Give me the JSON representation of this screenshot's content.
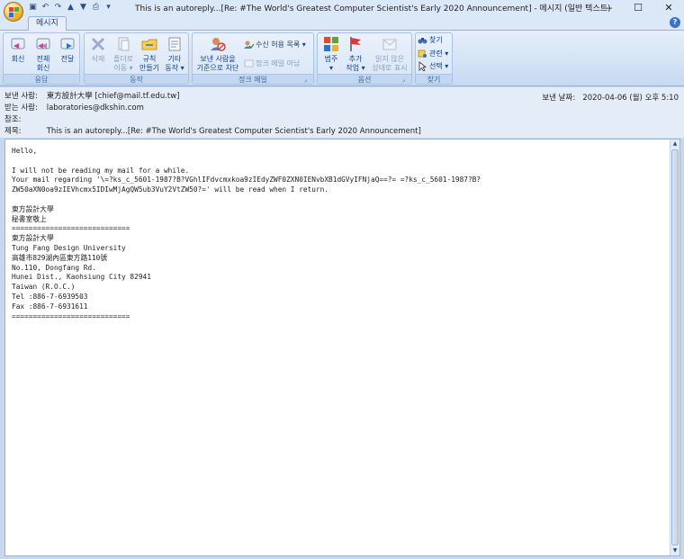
{
  "window": {
    "title": "This is an autoreply...[Re: #The World's Greatest Computer Scientist's Early 2020 Announcement] - 메시지 (일반 텍스트)",
    "minimize": "—",
    "maximize": "☐",
    "close": "✕"
  },
  "tabs": {
    "message": "메시지"
  },
  "ribbon": {
    "respond": {
      "label": "응답",
      "reply": "회신",
      "reply_all_1": "전체",
      "reply_all_2": "회신",
      "forward": "전달"
    },
    "actions": {
      "label": "동작",
      "delete": "삭제",
      "move_1": "폴더로",
      "move_2": "이동 ▾",
      "rules_1": "규칙",
      "rules_2": "만들기",
      "other_1": "기타",
      "other_2": "동작 ▾"
    },
    "junk": {
      "label": "정크 메일",
      "block_1": "보낸 사람을",
      "block_2": "기준으로 차단",
      "safe_list": "수신 허용 목록 ▾",
      "not_junk": "정크 메일 아님"
    },
    "options": {
      "label": "옵션",
      "categorize_1": "범주",
      "categorize_2": "▾",
      "followup_1": "추가",
      "followup_2": "작업 ▾",
      "mark_unread_1": "읽지 않은",
      "mark_unread_2": "상태로 표시"
    },
    "find": {
      "label": "찾기",
      "find": "찾기",
      "related": "관련 ▾",
      "select": "선택 ▾"
    }
  },
  "header": {
    "from_label": "보낸 사람:",
    "from_value": "東方設計大學 [chief@mail.tf.edu.tw]",
    "to_label": "받는 사람:",
    "to_value": "laboratories@dkshin.com",
    "cc_label": "참조:",
    "cc_value": "",
    "subject_label": "제목:",
    "subject_value": "This is an autoreply...[Re: #The World's Greatest Computer Scientist's Early 2020 Announcement]",
    "sent_label": "보낸 날짜:",
    "sent_value": "2020-04-06 (월) 오후 5:10"
  },
  "body": {
    "text": "Hello,\n\nI will not be reading my mail for a while.\nYour mail regarding '\\=?ks_c_5601-1987?B?VGhlIFdvcmxkoa9zIEdyZWF0ZXN0IENvbXB1dGVyIFNjaQ==?= =?ks_c_5601-1987?B?\nZW50aXN0oa9zIEVhcmx5IDIwMjAgQW5ub3VuY2VtZW50?=' will be read when I return.\n\n東方設計大學\n秘書室敬上\n============================\n東方設計大學\nTung Fang Design University\n高雄市829湖內區東方路110號\nNo.110, Dongfang Rd.\nHunei Dist., Kaohsiung City 82941\nTaiwan (R.O.C.)\nTel :886-7-6939503\nFax :886-7-6931611\n============================"
  },
  "colors": {
    "accent": "#15428b",
    "ribbon_bg": "#d3e2f5",
    "header_bg": "#e4ecf7"
  }
}
